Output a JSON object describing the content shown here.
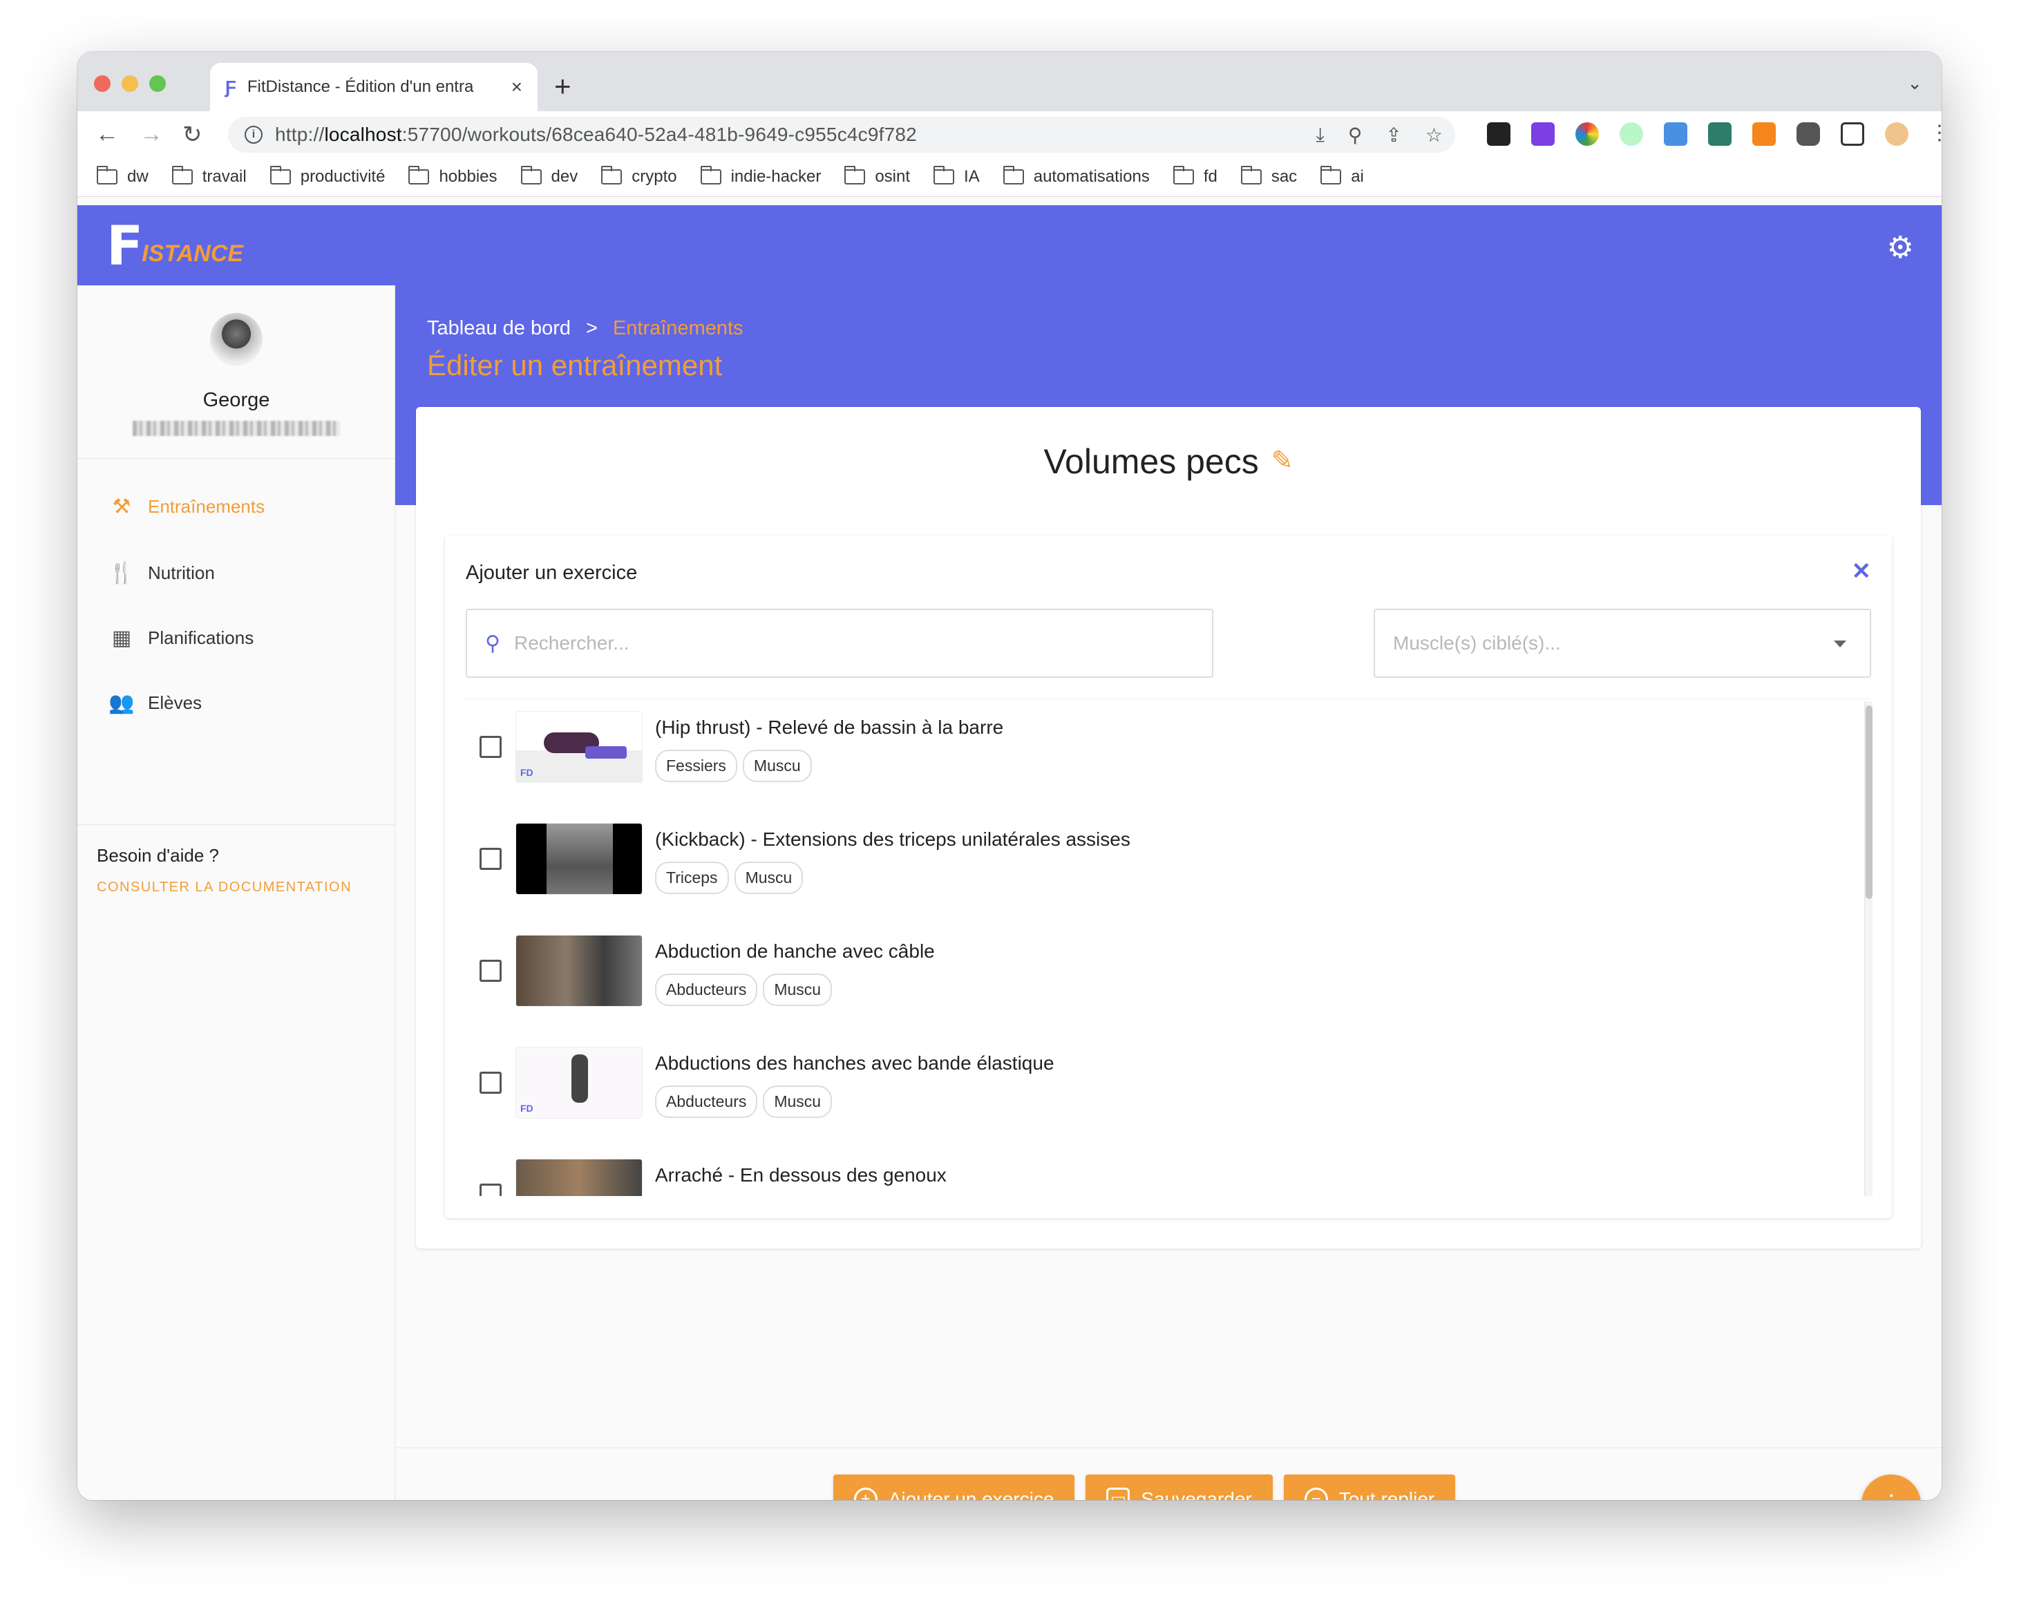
{
  "browser": {
    "tab_title": "FitDistance - Édition d'un entra",
    "url_prefix": "http://",
    "url_host": "localhost",
    "url_rest": ":57700/workouts/68cea640-52a4-481b-9649-c955c4c9f782",
    "bookmarks": [
      "dw",
      "travail",
      "productivité",
      "hobbies",
      "dev",
      "crypto",
      "indie-hacker",
      "osint",
      "IA",
      "automatisations",
      "fd",
      "sac",
      "ai"
    ]
  },
  "app": {
    "logo_letter": "F",
    "logo_text": "ISTANCE",
    "accent": "#f29d38",
    "brand": "#5e67e6"
  },
  "user": {
    "name": "George"
  },
  "nav": {
    "items": [
      {
        "label": "Entraînements",
        "icon": "dumbbell-icon"
      },
      {
        "label": "Nutrition",
        "icon": "utensils-icon"
      },
      {
        "label": "Planifications",
        "icon": "calendar-icon"
      },
      {
        "label": "Elèves",
        "icon": "users-icon"
      }
    ]
  },
  "help": {
    "title": "Besoin d'aide ?",
    "link": "CONSULTER LA DOCUMENTATION"
  },
  "breadcrumb": {
    "home": "Tableau de bord",
    "separator": ">",
    "current": "Entraînements"
  },
  "page": {
    "title": "Éditer un entraînement",
    "workout_name": "Volumes pecs"
  },
  "panel": {
    "title": "Ajouter un exercice",
    "search_placeholder": "Rechercher...",
    "muscle_placeholder": "Muscle(s) ciblé(s)..."
  },
  "exercises": [
    {
      "name": "(Hip thrust) - Relevé de bassin à la barre",
      "tags": [
        "Fessiers",
        "Muscu"
      ]
    },
    {
      "name": "(Kickback) - Extensions des triceps unilatérales assises",
      "tags": [
        "Triceps",
        "Muscu"
      ]
    },
    {
      "name": "Abduction de hanche avec câble",
      "tags": [
        "Abducteurs",
        "Muscu"
      ]
    },
    {
      "name": "Abductions des hanches avec bande élastique",
      "tags": [
        "Abducteurs",
        "Muscu"
      ]
    },
    {
      "name": "Arraché - En dessous des genoux",
      "tags": []
    }
  ],
  "actions": {
    "add": "Ajouter un exercice",
    "save": "Sauvegarder",
    "collapse": "Tout replier"
  }
}
